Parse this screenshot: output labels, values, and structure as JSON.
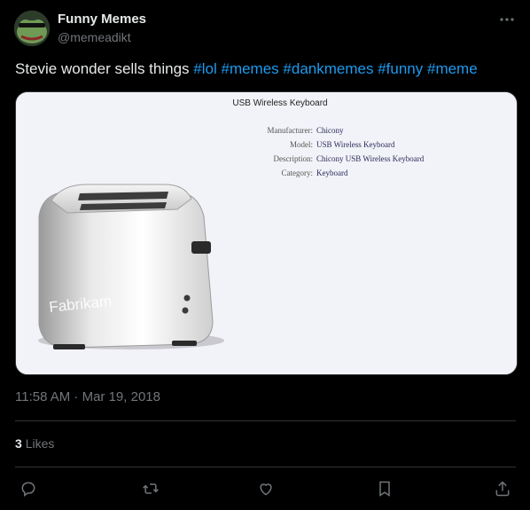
{
  "post": {
    "author_name": "Funny Memes",
    "author_handle": "@memeadikt",
    "text_plain": "Stevie wonder sells things",
    "hashtags": [
      "#lol",
      "#memes",
      "#dankmemes",
      "#funny",
      "#meme"
    ],
    "timestamp": "11:58 AM · Mar 19, 2018",
    "likes_count": "3",
    "likes_label": "Likes"
  },
  "media": {
    "window_title": "USB Wireless Keyboard",
    "props": [
      {
        "label": "Manufacturer:",
        "value": "Chicony"
      },
      {
        "label": "Model:",
        "value": "USB Wireless Keyboard"
      },
      {
        "label": "Description:",
        "value": "Chicony USB Wireless Keyboard"
      },
      {
        "label": "Category:",
        "value": "Keyboard"
      }
    ],
    "brand_text": "Fabrikam"
  },
  "icons": {
    "more": "more-icon",
    "reply": "reply-icon",
    "repost": "repost-icon",
    "like": "like-icon",
    "bookmark": "bookmark-icon",
    "share": "share-icon"
  },
  "colors": {
    "background": "#000000",
    "text": "#e7e9ea",
    "muted": "#71767b",
    "link": "#1d9bf0",
    "border": "#2f3336"
  }
}
